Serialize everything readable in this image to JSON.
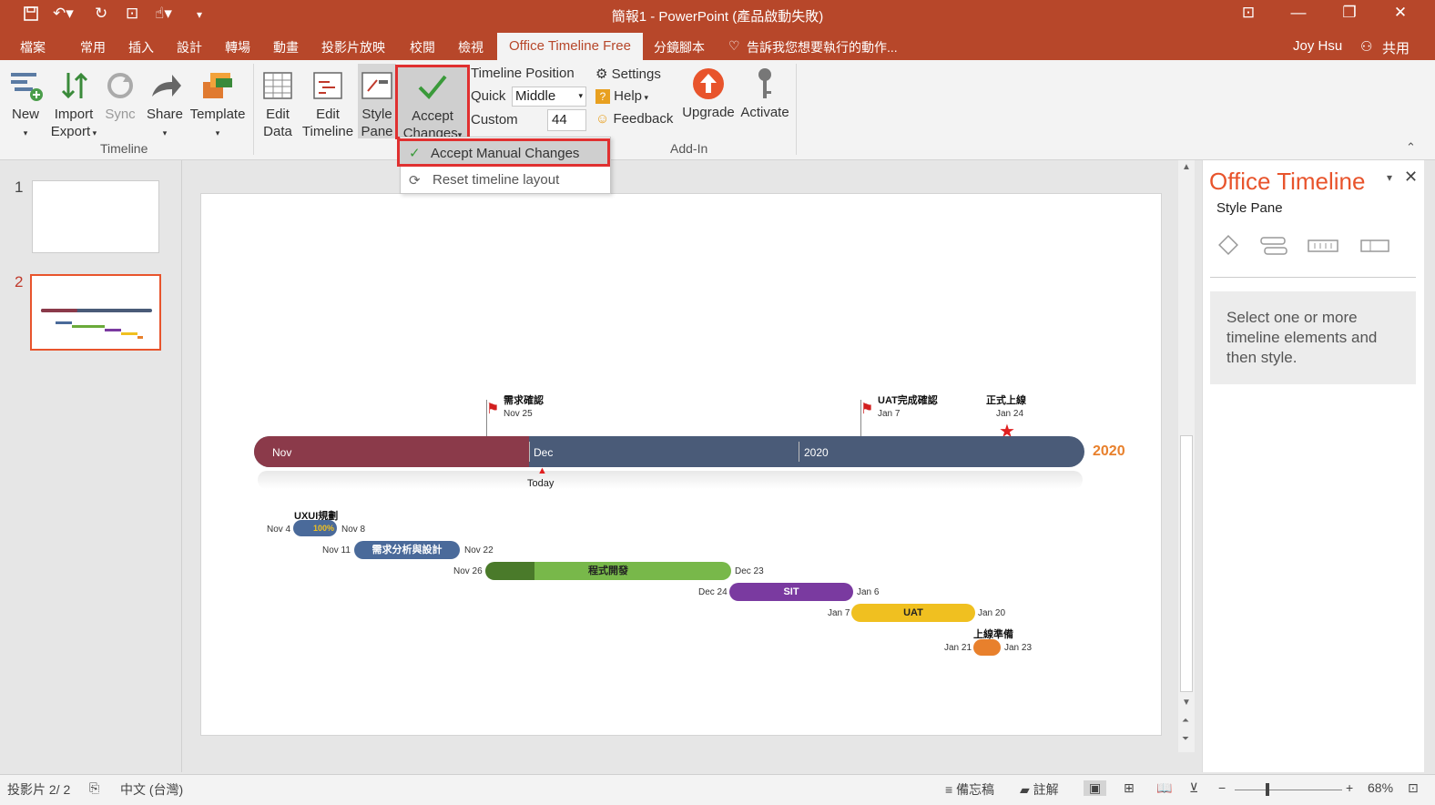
{
  "window": {
    "title": "簡報1 - PowerPoint (產品啟動失敗)"
  },
  "tabs": [
    "檔案",
    "常用",
    "插入",
    "設計",
    "轉場",
    "動畫",
    "投影片放映",
    "校閱",
    "檢視",
    "Office Timeline Free",
    "分鏡腳本"
  ],
  "tell_me": "告訴我您想要執行的動作...",
  "user": {
    "name": "Joy Hsu",
    "share": "共用"
  },
  "ribbon": {
    "new": "New",
    "import": "Import",
    "export": "Export",
    "sync": "Sync",
    "share": "Share",
    "template": "Template",
    "group_timeline": "Timeline",
    "edit_data_1": "Edit",
    "edit_data_2": "Data",
    "edit_timeline_1": "Edit",
    "edit_timeline_2": "Timeline",
    "style_pane_1": "Style",
    "style_pane_2": "Pane",
    "accept_1": "Accept",
    "accept_2": "Changes",
    "timeline_position": "Timeline Position",
    "quick": "Quick",
    "quick_value": "Middle",
    "custom": "Custom",
    "custom_value": "44",
    "settings": "Settings",
    "help": "Help",
    "feedback": "Feedback",
    "upgrade": "Upgrade",
    "activate": "Activate",
    "group_addin": "Add-In"
  },
  "dropdown": {
    "item1": "Accept Manual Changes",
    "item2": "Reset timeline layout"
  },
  "slides": [
    {
      "num": "1"
    },
    {
      "num": "2"
    }
  ],
  "timeline": {
    "year_label": "2020",
    "scale": [
      "Nov",
      "Dec",
      "2020"
    ],
    "today": "Today",
    "milestones": [
      {
        "title": "需求確認",
        "date": "Nov 25"
      },
      {
        "title": "UAT完成確認",
        "date": "Jan 7"
      },
      {
        "title": "正式上線",
        "date": "Jan 24"
      }
    ],
    "tasks": [
      {
        "title": "UXUI規劃",
        "start": "Nov 4",
        "end": "Nov 8",
        "progress": "100%"
      },
      {
        "title": "需求分析與設計",
        "start": "Nov 11",
        "end": "Nov 22"
      },
      {
        "title": "程式開發",
        "start": "Nov 26",
        "end": "Dec 23"
      },
      {
        "title": "SIT",
        "start": "Dec 24",
        "end": "Jan 6"
      },
      {
        "title": "UAT",
        "start": "Jan 7",
        "end": "Jan 20"
      },
      {
        "title": "上線準備",
        "start": "Jan 21",
        "end": "Jan 23"
      }
    ]
  },
  "pane": {
    "title": "Office Timeline",
    "subtitle": "Style Pane",
    "message": "Select one or more timeline elements and then style."
  },
  "status": {
    "slide": "投影片 2/ 2",
    "lang": "中文 (台灣)",
    "notes": "備忘稿",
    "comments": "註解",
    "zoom": "68%"
  },
  "colors": {
    "accent": "#b7472a",
    "highlight": "#e03030"
  }
}
